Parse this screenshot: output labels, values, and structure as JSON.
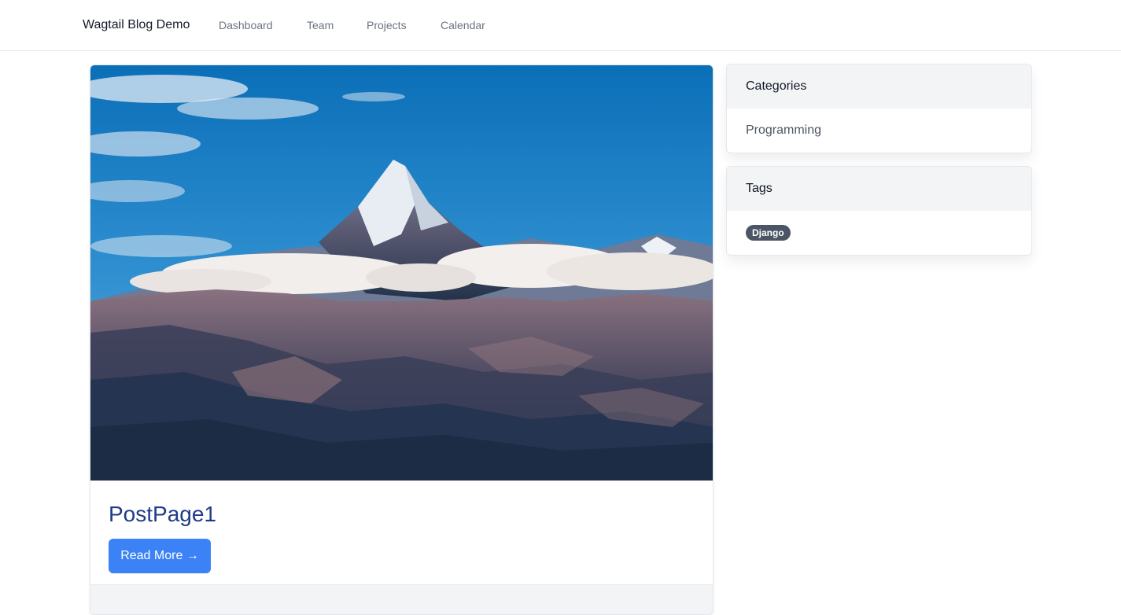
{
  "navbar": {
    "brand": "Wagtail Blog Demo",
    "links": [
      {
        "label": "Dashboard"
      },
      {
        "label": "Team"
      },
      {
        "label": "Projects"
      },
      {
        "label": "Calendar"
      }
    ]
  },
  "post": {
    "title": "PostPage1",
    "read_more_label": "Read More →",
    "hero_image": "mountain-peak-with-clouds"
  },
  "sidebar": {
    "categories": {
      "title": "Categories",
      "items": [
        {
          "label": "Programming"
        }
      ]
    },
    "tags": {
      "title": "Tags",
      "items": [
        {
          "label": "Django"
        }
      ]
    }
  },
  "colors": {
    "primary": "#3b82f6",
    "title_link": "#1e3a8a",
    "badge": "#4b5563"
  }
}
